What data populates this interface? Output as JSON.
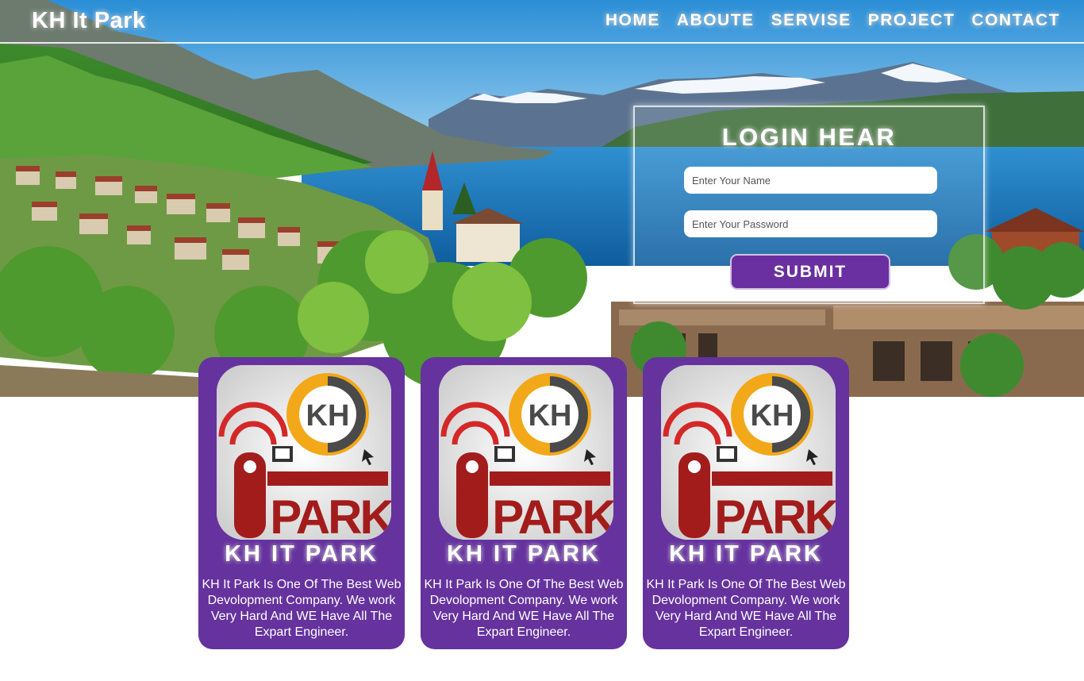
{
  "brand": "KH It Park",
  "nav": [
    "HOME",
    "ABOUTE",
    "SERVISE",
    "PROJECT",
    "CONTACT"
  ],
  "login": {
    "title": "LOGIN HEAR",
    "name_placeholder": "Enter Your Name",
    "password_placeholder": "Enter Your Password",
    "submit_label": "SUBMIT"
  },
  "cards": [
    {
      "title": "KH IT PARK",
      "text": "KH It Park Is One Of The Best Web Devolopment Company. We work Very Hard And WE Have All The Expart Engineer.",
      "logo_lettering": "KH IT PARK"
    },
    {
      "title": "KH IT PARK",
      "text": "KH It Park Is One Of The Best Web Devolopment Company. We work Very Hard And WE Have All The Expart Engineer.",
      "logo_lettering": "KH IT PARK"
    },
    {
      "title": "KH IT PARK",
      "text": "KH It Park Is One Of The Best Web Devolopment Company. We work Very Hard And WE Have All The Expart Engineer.",
      "logo_lettering": "KH IT PARK"
    }
  ],
  "colors": {
    "card_purple": "#65329e",
    "button_purple": "#6a2fa0",
    "logo_red": "#a31c1c",
    "logo_orange": "#f2a818",
    "logo_gray": "#4a4a4a"
  },
  "icons": [
    "lake-landscape-background",
    "kh-it-park-logo"
  ]
}
